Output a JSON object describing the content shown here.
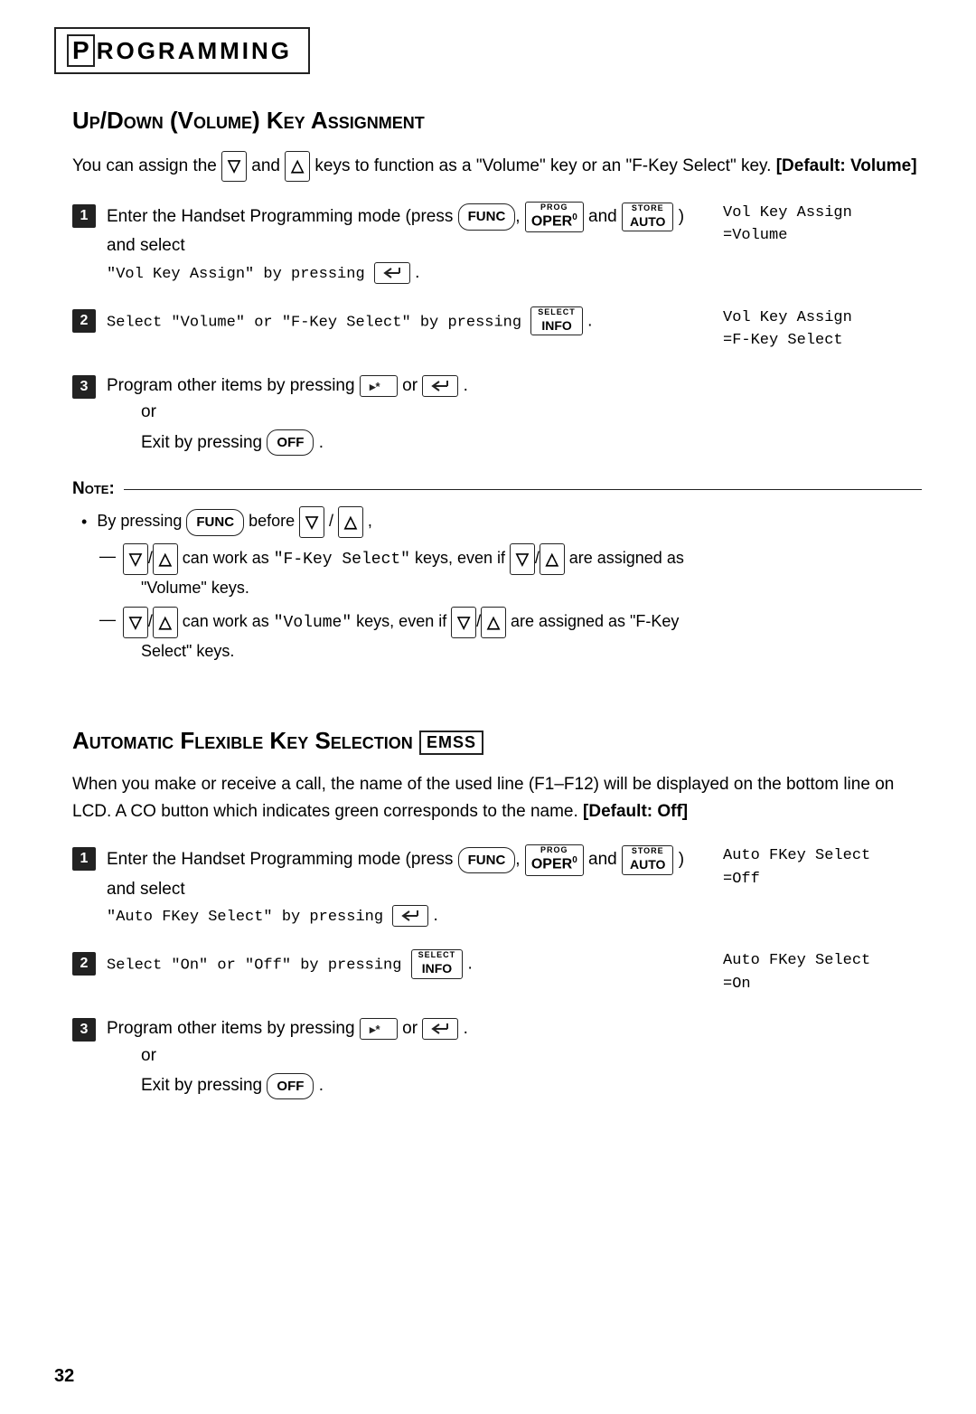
{
  "header": {
    "p_letter": "P",
    "rest": "ROGRAMMING"
  },
  "section1": {
    "title": "Up/Down (Volume) Key Assignment",
    "intro": "You can assign the",
    "intro2": "and",
    "intro3": "keys to function as a \"Volume\" key or an \"F-Key Select\" key.",
    "default_label": "[Default: Volume]",
    "steps": [
      {
        "num": "1",
        "text1": "Enter the Handset Programming mode (press",
        "text2": ") and select",
        "text3": "\"Vol Key Assign\" by pressing",
        "side": "Vol Key Assign\n=Volume"
      },
      {
        "num": "2",
        "text1": "Select \"Volume\" or \"F-Key Select\" by pressing",
        "text2": ".",
        "side": "Vol Key Assign\n=F-Key Select"
      },
      {
        "num": "3",
        "text1": "Program other items by pressing",
        "text2": "or",
        "text3": ".",
        "or_text": "or",
        "exit_text": "Exit by pressing",
        "exit_end": "."
      }
    ]
  },
  "note": {
    "title": "Note:",
    "items": [
      {
        "type": "bullet",
        "text1": "By pressing",
        "text2": "before",
        "text3": ","
      },
      {
        "type": "dash",
        "text1": "can work as \"F-Key Select\" keys, even if",
        "text2": "are assigned as \"Volume\" keys."
      },
      {
        "type": "dash",
        "text1": "can work as \"Volume\" keys, even if",
        "text2": "are assigned as \"F-Key Select\" keys."
      }
    ]
  },
  "section2": {
    "title": "Automatic Flexible Key Selection",
    "badge": "EMSS",
    "intro": "When you make or receive a call, the name of the used line (F1–F12) will be displayed on the bottom line on LCD. A CO button which indicates green corresponds to the name.",
    "default_label": "[Default: Off]",
    "steps": [
      {
        "num": "1",
        "text1": "Enter the Handset Programming mode (press",
        "text2": ") and select",
        "text3": "\"Auto FKey Select\" by pressing",
        "side": "Auto FKey Select\n=Off"
      },
      {
        "num": "2",
        "text1": "Select \"On\" or \"Off\" by pressing",
        "text2": ".",
        "side": "Auto FKey Select\n=On"
      },
      {
        "num": "3",
        "text1": "Program other items by pressing",
        "text2": "or",
        "text3": ".",
        "or_text": "or",
        "exit_text": "Exit by pressing",
        "exit_end": "."
      }
    ]
  },
  "page_number": "32"
}
